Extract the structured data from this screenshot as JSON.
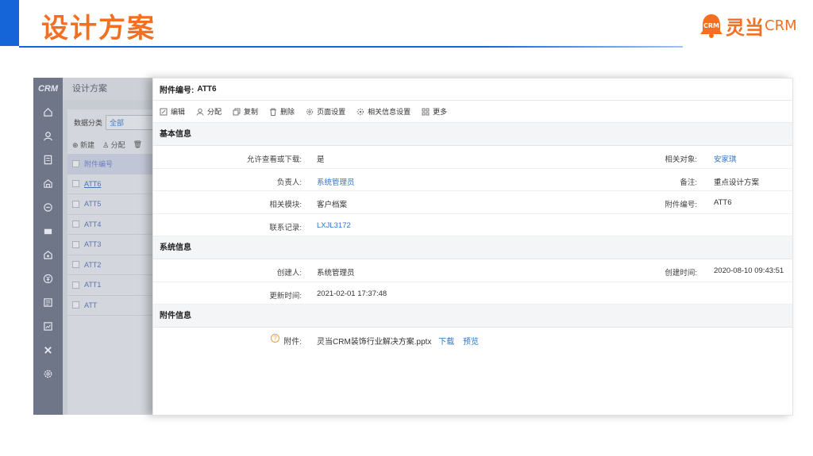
{
  "slide": {
    "title": "设计方案",
    "logo_text": "灵当",
    "logo_crm": "CRM",
    "logo_badge": "CRM"
  },
  "colors": {
    "accent": "#f36f21",
    "brand_blue": "#1565d8",
    "link": "#2f75c7"
  },
  "rail": {
    "brand": "CRM",
    "icons": [
      "home-icon",
      "user-icon",
      "document-icon",
      "building-icon",
      "circle-minus-icon",
      "card-icon",
      "house-icon",
      "yen-icon",
      "report-icon",
      "chart-icon",
      "tools-icon",
      "gear-icon"
    ]
  },
  "list": {
    "header": "设计方案",
    "filter_label": "数据分类",
    "filter_value": "全部",
    "tools": [
      "新建",
      "分配"
    ],
    "column": "附件编号",
    "rows": [
      "ATT6",
      "ATT5",
      "ATT4",
      "ATT3",
      "ATT2",
      "ATT1",
      "ATT"
    ]
  },
  "detail": {
    "header_label": "附件编号:",
    "header_value": "ATT6",
    "toolbar": [
      {
        "label": "编辑",
        "icon": "edit-icon"
      },
      {
        "label": "分配",
        "icon": "user-icon"
      },
      {
        "label": "复制",
        "icon": "copy-icon"
      },
      {
        "label": "删除",
        "icon": "trash-icon"
      },
      {
        "label": "页面设置",
        "icon": "gear-icon"
      },
      {
        "label": "相关信息设置",
        "icon": "cog-icon"
      },
      {
        "label": "更多",
        "icon": "grid-icon"
      }
    ],
    "basic": {
      "title": "基本信息",
      "rows": [
        {
          "l1": "允许查看或下载:",
          "v1": "是",
          "l2": "相关对象:",
          "v2": "安家琪"
        },
        {
          "l1": "负责人:",
          "v1": "系统管理员",
          "l2": "备注:",
          "v2": "重点设计方案"
        },
        {
          "l1": "相关模块:",
          "v1": "客户档案",
          "l2": "附件编号:",
          "v2": "ATT6"
        },
        {
          "l1": "联系记录:",
          "v1": "LXJL3172",
          "l2": "",
          "v2": ""
        }
      ]
    },
    "system": {
      "title": "系统信息",
      "rows": [
        {
          "l1": "创建人:",
          "v1": "系统管理员",
          "l2": "创建时间:",
          "v2": "2020-08-10 09:43:51"
        },
        {
          "l1": "更新时间:",
          "v1": "2021-02-01 17:37:48",
          "l2": "",
          "v2": ""
        }
      ]
    },
    "attach": {
      "title": "附件信息",
      "label": "附件:",
      "file": "灵当CRM装饰行业解决方案.pptx",
      "download": "下载",
      "preview": "预览"
    }
  }
}
